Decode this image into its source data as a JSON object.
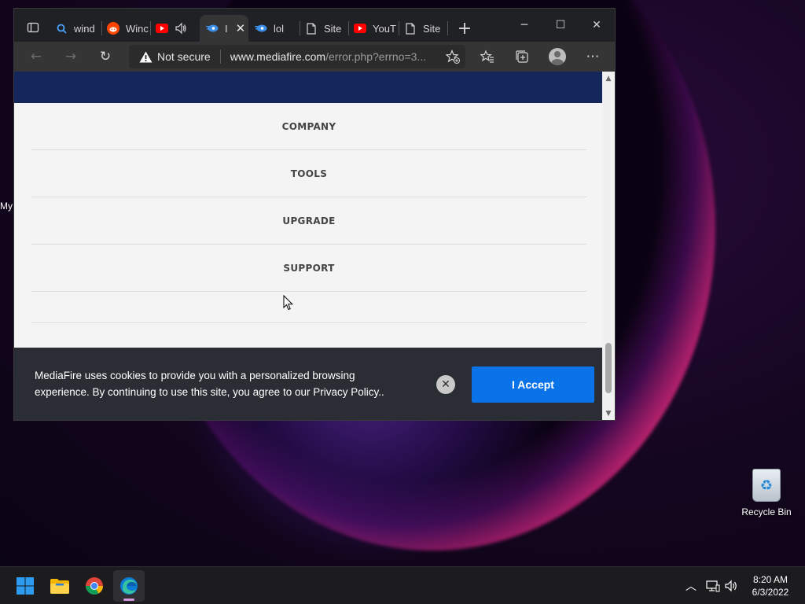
{
  "desktop": {
    "partial_label": "My",
    "recycle_bin_label": "Recycle Bin"
  },
  "browser": {
    "tabs": [
      {
        "title": "wind",
        "icon": "search-icon"
      },
      {
        "title": "Winc",
        "icon": "reddit-icon"
      },
      {
        "title": "",
        "icon": "youtube-icon",
        "audio": "speaker-icon"
      },
      {
        "title": "I",
        "icon": "mediafire-icon",
        "active": true
      },
      {
        "title": "lol",
        "icon": "mediafire-icon"
      },
      {
        "title": "Site",
        "icon": "page-icon"
      },
      {
        "title": "YouT",
        "icon": "youtube-icon"
      },
      {
        "title": "Site",
        "icon": "page-icon"
      }
    ],
    "address": {
      "security_label": "Not secure",
      "url_host": "www.mediafire.com",
      "url_rest": "/error.php?errno=3..."
    }
  },
  "page": {
    "nav_items": [
      "COMPANY",
      "TOOLS",
      "UPGRADE",
      "SUPPORT"
    ],
    "cookie_banner": {
      "text_line1": "MediaFire uses cookies to provide you with a personalized browsing",
      "text_line2": "experience. By continuing to use this site, you agree to our Privacy Policy..",
      "close_symbol": "✕",
      "accept_label": "I Accept"
    }
  },
  "taskbar": {
    "apps": [
      "start-icon",
      "file-explorer-icon",
      "chrome-icon",
      "edge-icon"
    ],
    "clock_time": "8:20 AM",
    "clock_date": "6/3/2022"
  },
  "colors": {
    "banner_blue": "#14265c",
    "accept_blue": "#0a73e8",
    "cookie_bg": "#2a2d33"
  }
}
